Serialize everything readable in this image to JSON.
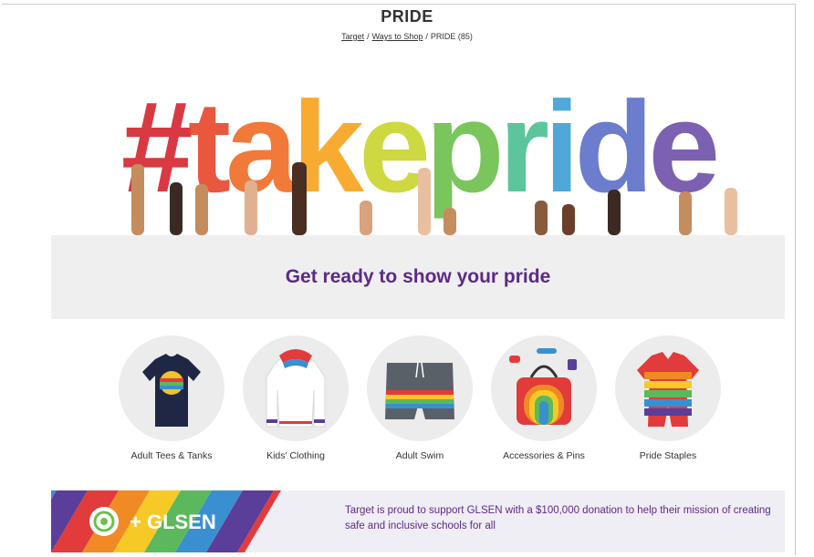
{
  "page": {
    "title": "PRIDE",
    "breadcrumb": {
      "items": [
        "Target",
        "Ways to Shop"
      ],
      "current": "PRIDE (85)",
      "separator": "/"
    }
  },
  "hero": {
    "text": "#takepride",
    "letter_colors": [
      "#d5242f",
      "#e8452a",
      "#ef6a23",
      "#f7a21b",
      "#c9d42c",
      "#6cc04a",
      "#4bbf92",
      "#3d9fd6",
      "#5b6fc7",
      "#6e4fa8",
      "#8d5bb8"
    ]
  },
  "promo": {
    "heading": "Get ready to show your pride",
    "color": "#5b2a86"
  },
  "categories": [
    {
      "label": "Adult Tees & Tanks",
      "icon": "tshirt-icon"
    },
    {
      "label": "Kids' Clothing",
      "icon": "hoodie-icon"
    },
    {
      "label": "Adult Swim",
      "icon": "swim-trunks-icon"
    },
    {
      "label": "Accessories & Pins",
      "icon": "bag-icon"
    },
    {
      "label": "Pride Staples",
      "icon": "romper-icon"
    }
  ],
  "banner": {
    "logo_text": "+ GLSEN",
    "message": "Target is proud to support GLSEN with a $100,000 donation to help their mission of creating safe and inclusive schools for all",
    "stripe_colors": [
      "#e23b3b",
      "#f08a24",
      "#f6c927",
      "#5cb85c",
      "#3a8fd1",
      "#5b3d9a"
    ]
  }
}
